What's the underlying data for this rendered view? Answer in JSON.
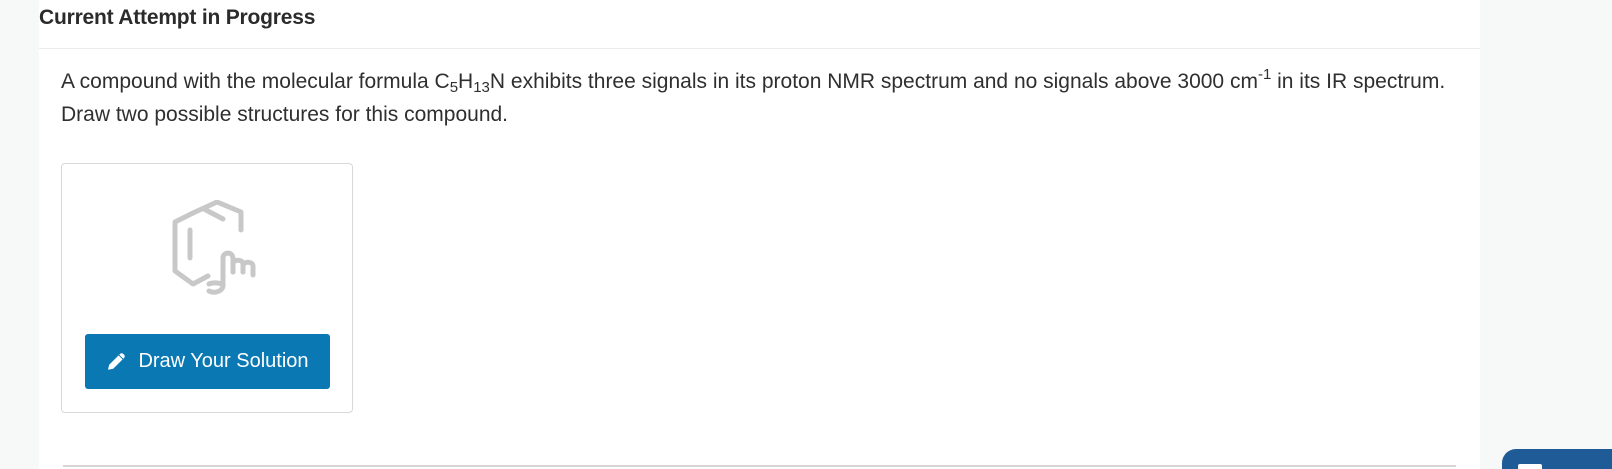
{
  "status": {
    "title": "Current Attempt in Progress"
  },
  "question": {
    "prefix": "A compound with the molecular formula C",
    "sub_c": "5",
    "h": "H",
    "sub_h": "13",
    "middle": "N exhibits three signals in its proton NMR spectrum and no signals above 3000 cm",
    "superscript": "-1",
    "suffix": " in its IR spectrum. Draw two possible structures for this compound."
  },
  "drawing_tool": {
    "icon": "molecule-drawing-icon",
    "button_icon": "pencil-icon",
    "button_label": "Draw Your Solution"
  },
  "colors": {
    "primary_button": "#0a78b3",
    "floating_tab": "#1f5b97",
    "card_border": "#d8d8d8"
  }
}
